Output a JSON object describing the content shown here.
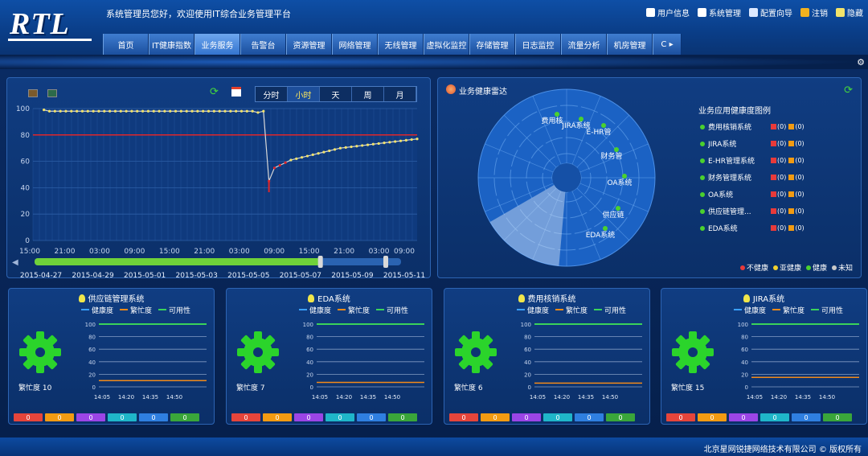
{
  "header": {
    "logo": "RTL",
    "welcome": "系统管理员您好，欢迎使用IT综合业务管理平台",
    "user_menu": [
      {
        "label": "用户信息",
        "icon": "user-info-icon",
        "color": "#ffffff"
      },
      {
        "label": "系统管理",
        "icon": "gear-icon",
        "color": "#ffffff"
      },
      {
        "label": "配置向导",
        "icon": "config-wizard-icon",
        "color": "#dce8ff"
      },
      {
        "label": "注销",
        "icon": "logout-icon",
        "color": "#f2b11f"
      },
      {
        "label": "隐藏",
        "icon": "hide-icon",
        "color": "#f2e36a"
      }
    ]
  },
  "nav": {
    "tabs": [
      "首页",
      "IT健康指数",
      "业务服务",
      "告警台",
      "资源管理",
      "网络管理",
      "无线管理",
      "虚拟化监控",
      "存储管理",
      "日志监控",
      "流量分析",
      "机房管理",
      "C ▸"
    ],
    "active_index": 2
  },
  "trend": {
    "periods": [
      "分时",
      "小时",
      "天",
      "周",
      "月"
    ],
    "active_period": 1,
    "y_ticks": [
      "100",
      "80",
      "60",
      "40",
      "20",
      "0"
    ],
    "x_ticks": [
      "15:00",
      "21:00",
      "03:00",
      "09:00",
      "15:00",
      "21:00",
      "03:00",
      "09:00",
      "15:00",
      "21:00",
      "03:00",
      "09:00"
    ],
    "slider_dates": [
      "2015-04-27",
      "2015-04-29",
      "2015-05-01",
      "2015-05-03",
      "2015-05-05",
      "2015-05-07",
      "2015-05-09",
      "2015-05-11"
    ],
    "slider_range": [
      0,
      0.78
    ]
  },
  "chart_data": [
    {
      "type": "line",
      "title": "",
      "ylim": [
        0,
        100
      ],
      "x": [
        "15:00",
        "21:00",
        "03:00",
        "09:00",
        "15:00",
        "21:00",
        "03:00",
        "09:00",
        "15:00",
        "21:00",
        "03:00",
        "09:00"
      ],
      "threshold": 80,
      "series": [
        {
          "values": [
            null,
            null,
            99,
            98,
            98,
            98,
            98,
            98,
            98,
            98,
            98,
            98,
            98,
            98,
            98,
            98,
            98,
            98,
            98,
            98,
            98,
            98,
            98,
            98,
            98,
            98,
            98,
            98,
            98,
            98,
            98,
            98,
            98,
            98,
            98,
            98,
            98,
            98,
            98,
            98,
            98,
            97,
            98,
            45,
            55,
            57,
            59,
            61,
            62,
            63,
            64,
            65,
            66,
            67,
            68,
            69,
            70,
            70.5,
            71,
            71.5,
            72,
            72.5,
            73,
            73.5,
            74,
            74.5,
            75,
            75.5,
            76,
            76.5,
            77
          ]
        }
      ]
    }
  ],
  "radar": {
    "title": "业务健康雷达",
    "systems": [
      "费用核",
      "JIRA系统",
      "E-HR管",
      "财务管",
      "OA系统",
      "供应链",
      "EDA系统"
    ]
  },
  "health_legend": {
    "title": "业务应用健康度图例",
    "items": [
      {
        "name": "费用核销系统",
        "c1": "(0)",
        "c2": "(0)"
      },
      {
        "name": "JIRA系统",
        "c1": "(0)",
        "c2": "(0)"
      },
      {
        "name": "E-HR管理系统",
        "c1": "(0)",
        "c2": "(0)"
      },
      {
        "name": "财务管理系统",
        "c1": "(0)",
        "c2": "(0)"
      },
      {
        "name": "OA系统",
        "c1": "(0)",
        "c2": "(0)"
      },
      {
        "name": "供应链管理...",
        "c1": "(0)",
        "c2": "(0)"
      },
      {
        "name": "EDA系统",
        "c1": "(0)",
        "c2": "(0)"
      }
    ]
  },
  "status_legend": [
    {
      "label": "不健康",
      "color": "#e83a3a"
    },
    {
      "label": "亚健康",
      "color": "#f2d22e"
    },
    {
      "label": "健康",
      "color": "#4bd12e"
    },
    {
      "label": "未知",
      "color": "#c9c9c9"
    }
  ],
  "cards": [
    {
      "title": "供应链管理系统",
      "busy_label": "繁忙度",
      "busy": "10",
      "busy_value": 10
    },
    {
      "title": "EDA系统",
      "busy_label": "繁忙度",
      "busy": "7",
      "busy_value": 7
    },
    {
      "title": "费用核销系统",
      "busy_label": "繁忙度",
      "busy": "6",
      "busy_value": 6
    },
    {
      "title": "JIRA系统",
      "busy_label": "繁忙度",
      "busy": "15",
      "busy_value": 15
    }
  ],
  "card_common": {
    "legend": [
      "健康度",
      "繁忙度",
      "可用性"
    ],
    "legend_colors": [
      "#3aa0ff",
      "#f28a1a",
      "#3ad35a"
    ],
    "y_ticks": [
      "100",
      "80",
      "60",
      "40",
      "20",
      "0"
    ],
    "x_ticks": [
      "14:05",
      "14:20",
      "14:35",
      "14:50"
    ],
    "availability": 100,
    "buttons": [
      "0",
      "0",
      "0",
      "0",
      "0",
      "0"
    ],
    "button_colors": [
      "#e5453b",
      "#f29b12",
      "#9b45e6",
      "#1fb6c9",
      "#2f7fe0",
      "#3aa63a"
    ]
  },
  "footer": {
    "text": "北京星网锐捷网络技术有限公司 © 版权所有"
  }
}
